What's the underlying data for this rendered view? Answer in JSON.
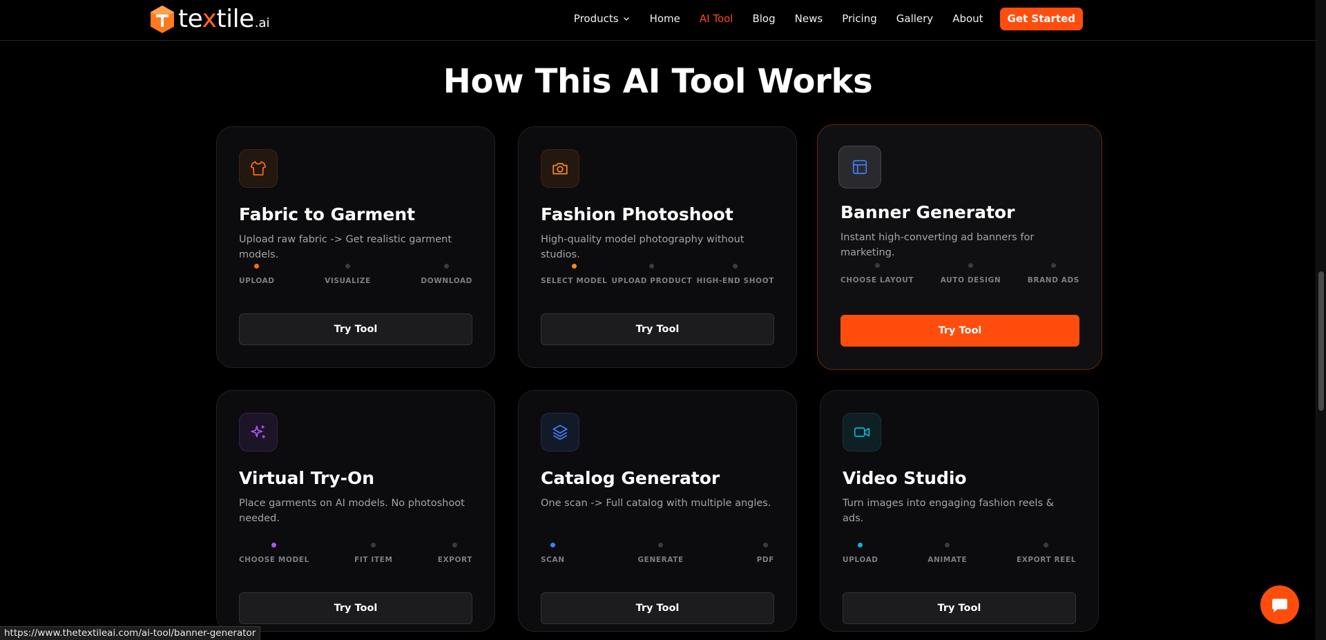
{
  "brand": {
    "name_pre": "te",
    "name_x": "x",
    "name_post": "tile",
    "name_suffix": ".ai"
  },
  "nav": {
    "items": [
      {
        "label": "Products"
      },
      {
        "label": "Home"
      },
      {
        "label": "AI Tool"
      },
      {
        "label": "Blog"
      },
      {
        "label": "News"
      },
      {
        "label": "Pricing"
      },
      {
        "label": "Gallery"
      },
      {
        "label": "About"
      }
    ],
    "cta": "Get Started",
    "active_color": "#ff4a1a"
  },
  "section": {
    "title": "How This AI Tool Works"
  },
  "cards": [
    {
      "title": "Fabric to Garment",
      "desc": "Upload raw fabric -> Get realistic garment models.",
      "icon": "shirt-icon",
      "accent": "#ff6a1a",
      "steps": [
        "UPLOAD",
        "VISUALIZE",
        "DOWNLOAD"
      ],
      "button": "Try Tool"
    },
    {
      "title": "Fashion Photoshoot",
      "desc": "High-quality model photography without studios.",
      "icon": "camera-icon",
      "accent": "#ff8a1a",
      "steps": [
        "SELECT MODEL",
        "UPLOAD PRODUCT",
        "HIGH-END SHOOT"
      ],
      "button": "Try Tool"
    },
    {
      "title": "Banner Generator",
      "desc": "Instant high-converting ad banners for marketing.",
      "icon": "layout-icon",
      "accent": "#3b82f6",
      "steps": [
        "CHOOSE LAYOUT",
        "AUTO DESIGN",
        "BRAND ADS"
      ],
      "button": "Try Tool"
    },
    {
      "title": "Virtual Try-On",
      "desc": "Place garments on AI models. No photoshoot needed.",
      "icon": "sparkles-icon",
      "accent": "#a855f7",
      "steps": [
        "CHOOSE MODEL",
        "FIT ITEM",
        "EXPORT"
      ],
      "button": "Try Tool"
    },
    {
      "title": "Catalog Generator",
      "desc": "One scan -> Full catalog with multiple angles.",
      "icon": "layers-icon",
      "accent": "#3b82f6",
      "steps": [
        "SCAN",
        "GENERATE",
        "PDF"
      ],
      "button": "Try Tool"
    },
    {
      "title": "Video Studio",
      "desc": "Turn images into engaging fashion reels & ads.",
      "icon": "video-icon",
      "accent": "#06b6d4",
      "steps": [
        "UPLOAD",
        "ANIMATE",
        "EXPORT REEL"
      ],
      "button": "Try Tool"
    }
  ],
  "status_url": "https://www.thetextileai.com/ai-tool/banner-generator"
}
